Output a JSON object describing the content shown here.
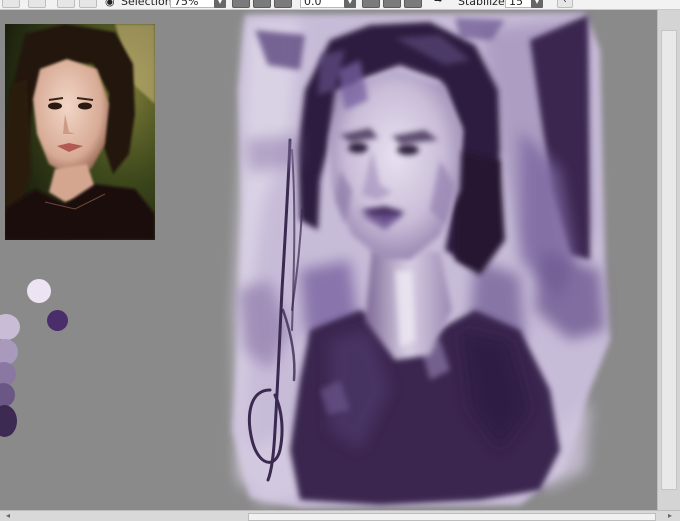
{
  "toolbar": {
    "selection_label": "Selection",
    "zoom_value": "75%",
    "rotation_value": "0.0",
    "stabilizer_label": "Stabilizer",
    "stabilizer_value": "15",
    "icons": [
      "eye-icon",
      "chevron-down-icon",
      "undo-icon",
      "redo-icon",
      "arrow-icon",
      "back-icon"
    ]
  },
  "palette": {
    "colors": [
      "#ece4f2",
      "#4a2d6b",
      "#c8bcd6",
      "#a99abd",
      "#8a78a3",
      "#6b5785",
      "#3d2a52"
    ]
  },
  "colors": {
    "canvas_bg": "#8a8a8a",
    "painting_light": "#c9bedb",
    "painting_dark": "#35224a",
    "hair": "#2e1f3f"
  }
}
